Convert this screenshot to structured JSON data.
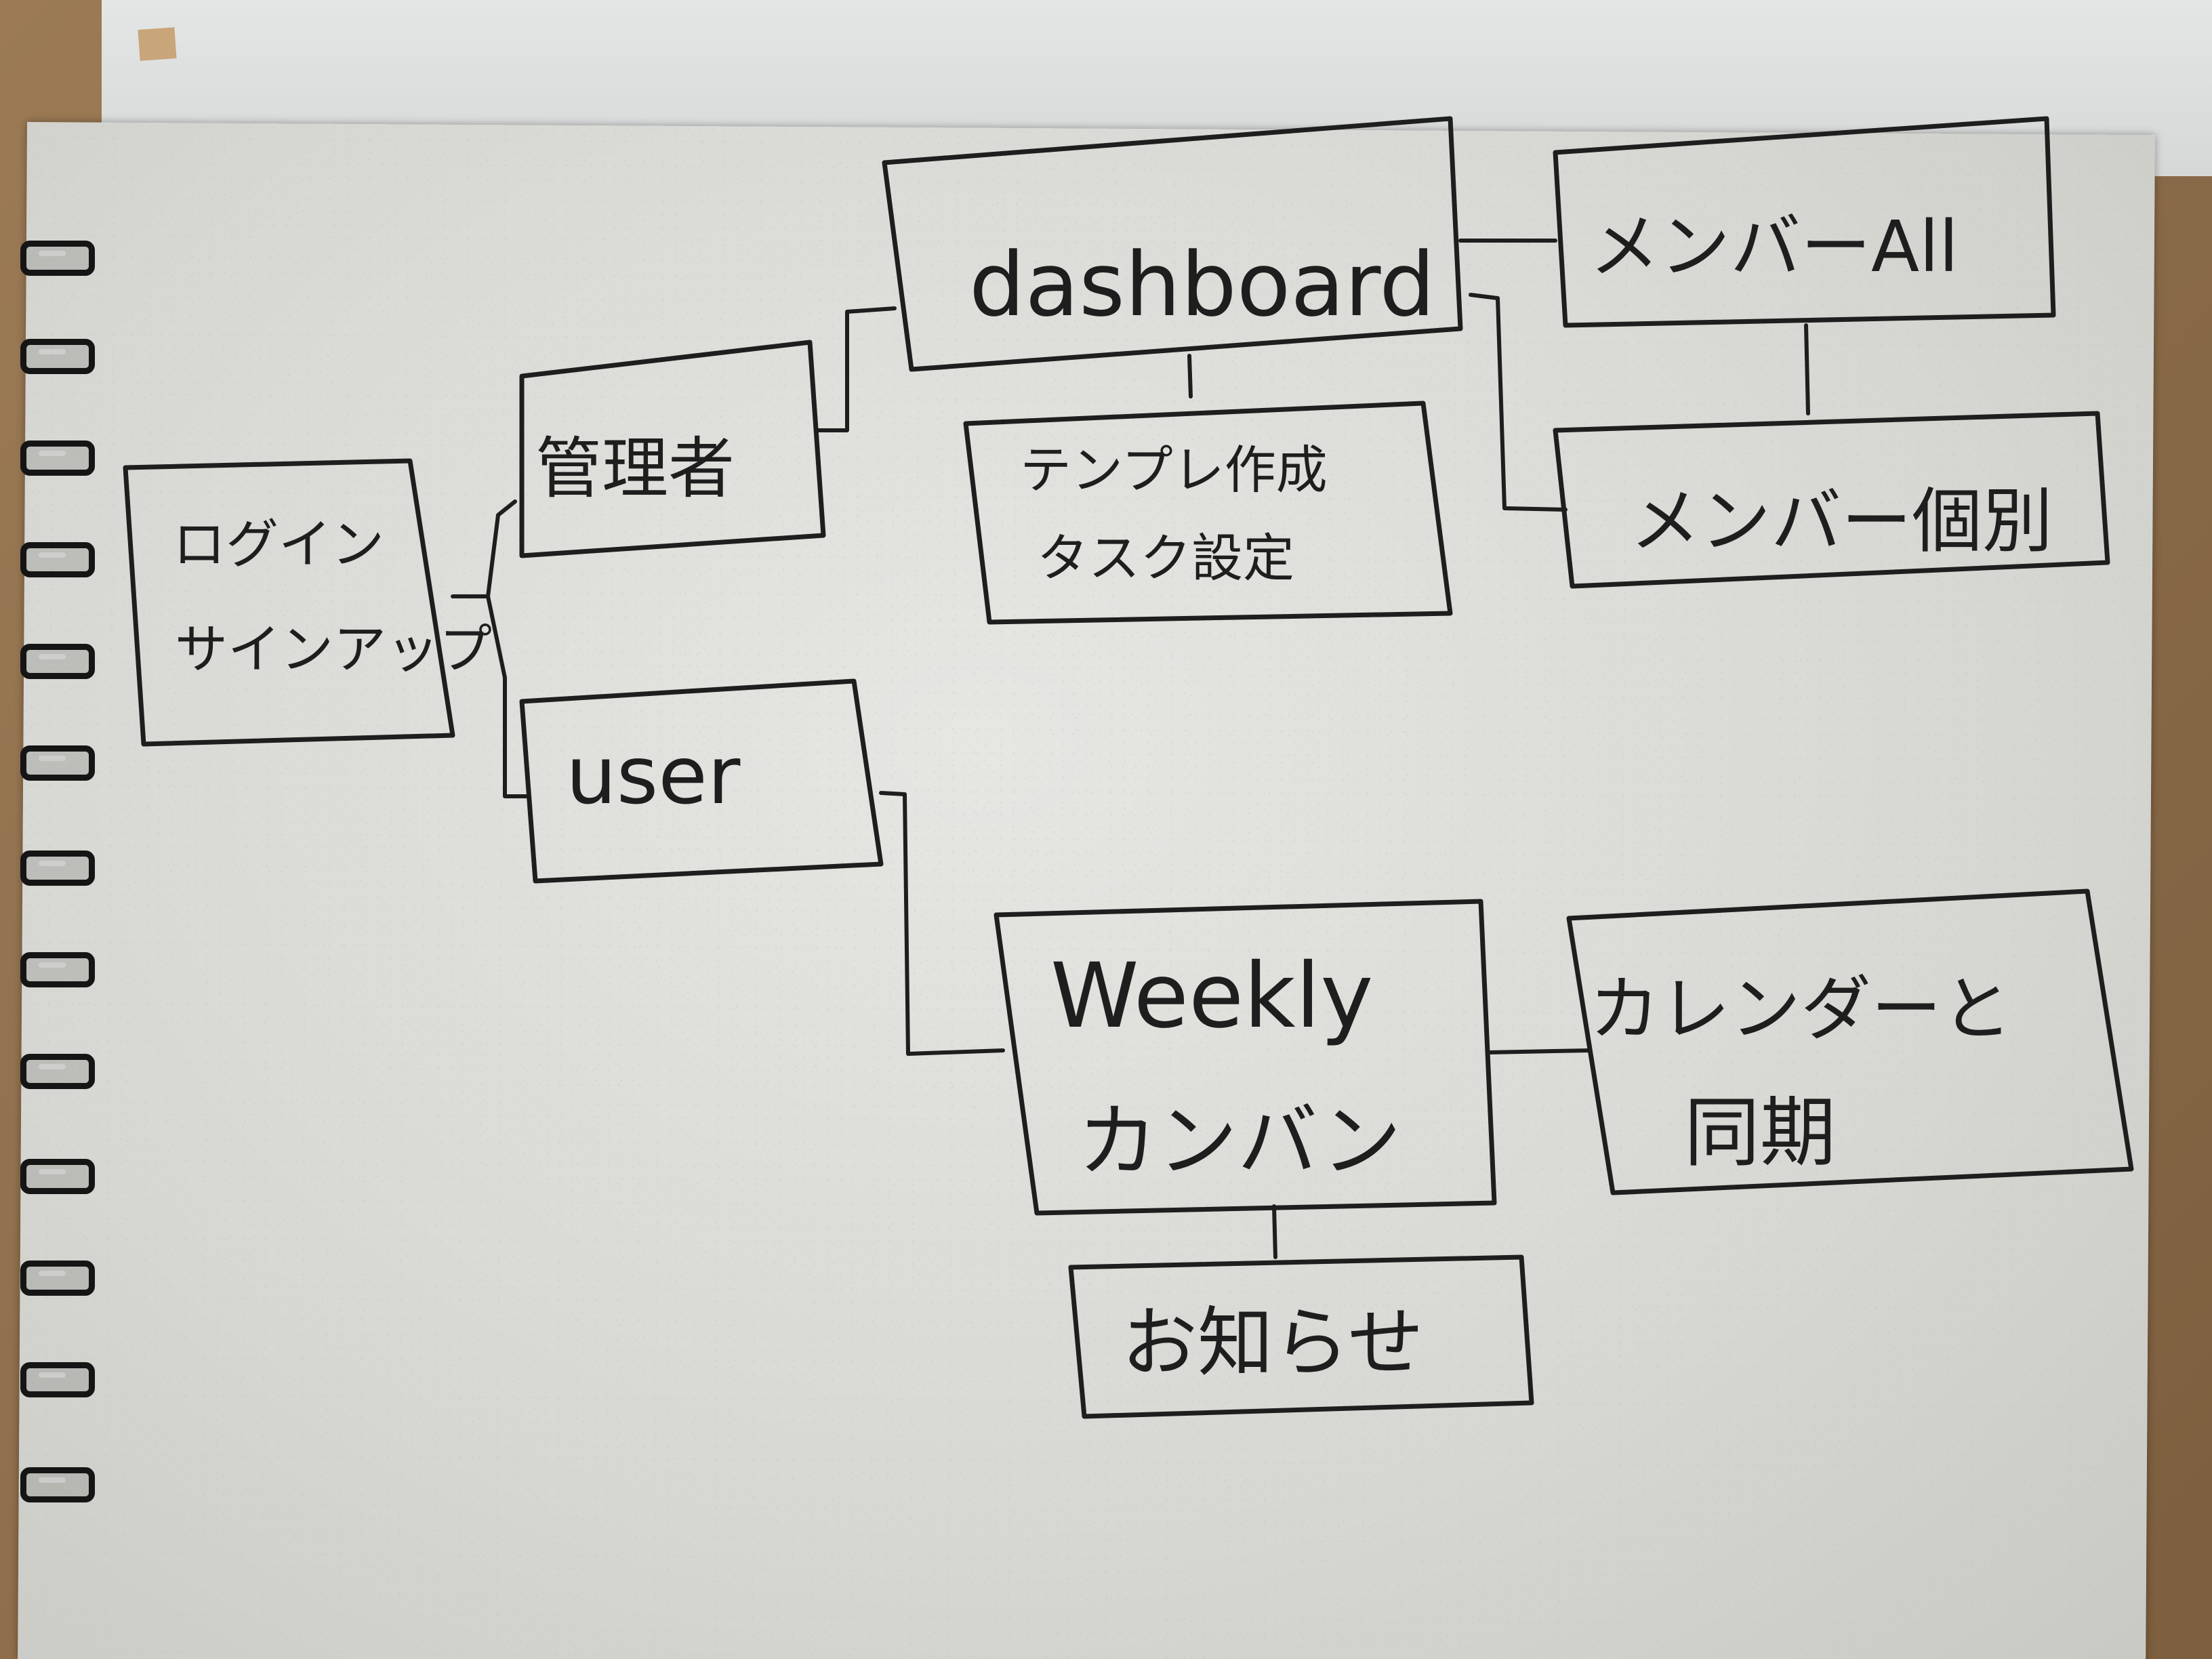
{
  "nodes": {
    "login": {
      "lines": [
        "ログイン",
        "サインアップ"
      ]
    },
    "admin": {
      "lines": [
        "管理者"
      ]
    },
    "user": {
      "lines": [
        "user"
      ]
    },
    "dashboard": {
      "lines": [
        "dashboard"
      ]
    },
    "template": {
      "lines": [
        "テンプレ作成",
        "タスク設定"
      ]
    },
    "member_all": {
      "lines": [
        "メンバーAll"
      ]
    },
    "member_each": {
      "lines": [
        "メンバー個別"
      ]
    },
    "weekly": {
      "lines": [
        "Weekly",
        "カンバン"
      ]
    },
    "calendar": {
      "lines": [
        "カレンダーと",
        "同期"
      ]
    },
    "notice": {
      "lines": [
        "お知らせ"
      ]
    }
  },
  "edges": [
    {
      "from": "login",
      "to": "admin"
    },
    {
      "from": "login",
      "to": "user"
    },
    {
      "from": "admin",
      "to": "dashboard"
    },
    {
      "from": "dashboard",
      "to": "template"
    },
    {
      "from": "dashboard",
      "to": "member_all"
    },
    {
      "from": "dashboard",
      "to": "member_each"
    },
    {
      "from": "member_all",
      "to": "member_each"
    },
    {
      "from": "user",
      "to": "weekly"
    },
    {
      "from": "weekly",
      "to": "calendar"
    },
    {
      "from": "weekly",
      "to": "notice"
    }
  ]
}
